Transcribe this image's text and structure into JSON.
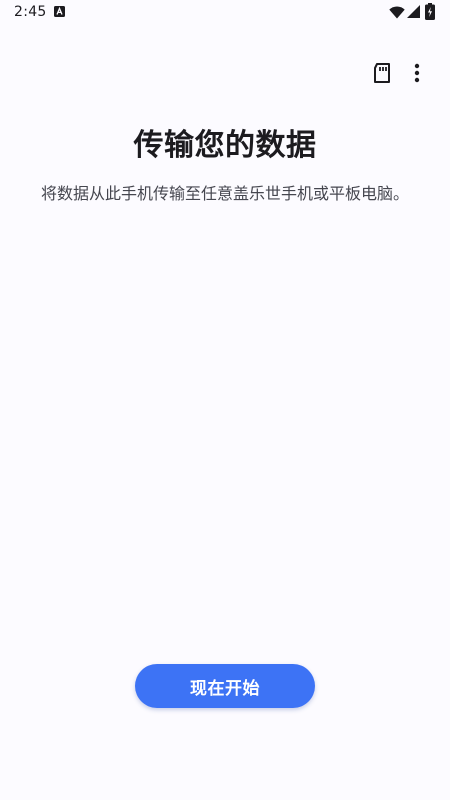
{
  "status_bar": {
    "time": "2:45",
    "notification_icon": "app-notification-icon",
    "wifi_icon": "wifi-icon",
    "signal_icon": "cellular-signal-icon",
    "battery_icon": "battery-charging-icon"
  },
  "toolbar": {
    "sd_card_icon": "sd-card-icon",
    "more_icon": "more-vert-icon"
  },
  "main": {
    "title": "传输您的数据",
    "subtitle": "将数据从此手机传输至任意盖乐世手机或平板电脑。"
  },
  "actions": {
    "start_label": "现在开始"
  },
  "colors": {
    "background": "#fcfbff",
    "accent": "#3d73f5",
    "text_primary": "#1c1b1f",
    "text_secondary": "#45464f"
  }
}
